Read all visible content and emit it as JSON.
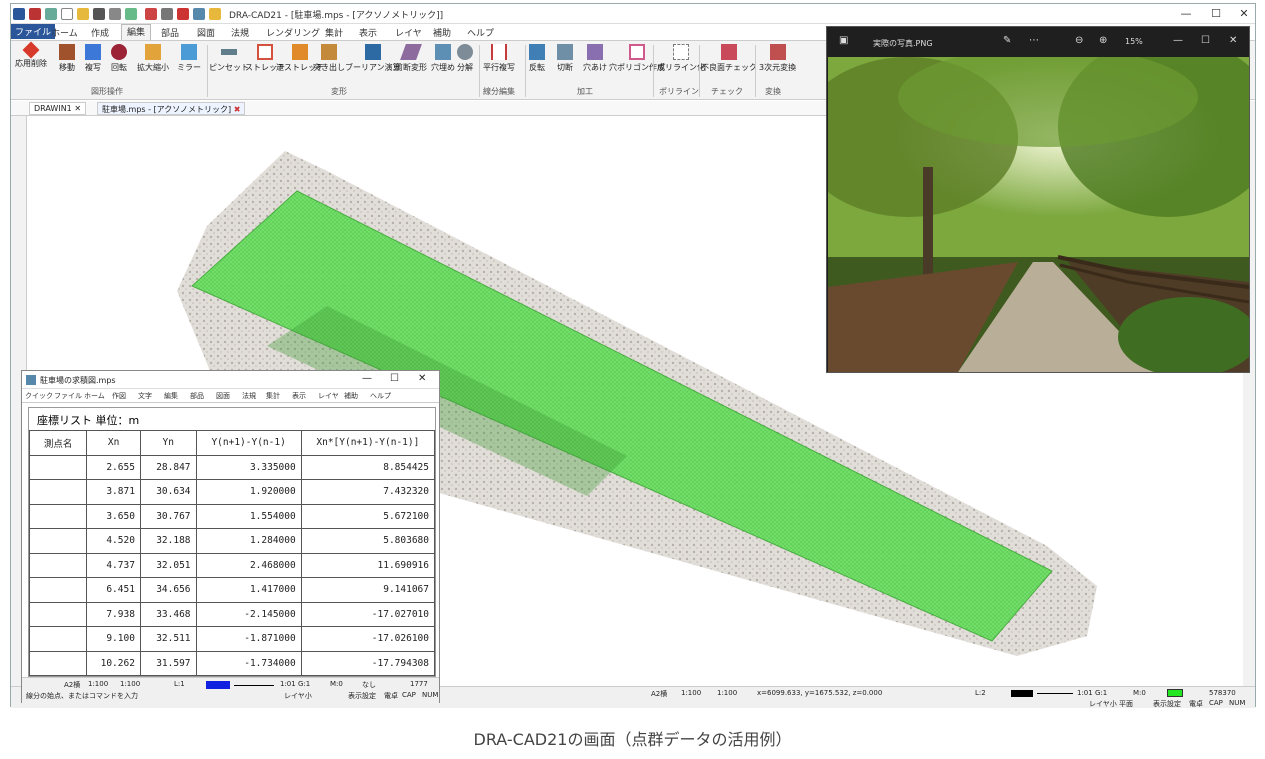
{
  "app": {
    "title": "DRA-CAD21 - [駐車場.mps - [アクソノメトリック]]",
    "window_controls": [
      "—",
      "☐",
      "✕"
    ]
  },
  "menu": {
    "items": [
      "ファイル",
      "ホーム",
      "作成",
      "編集",
      "部品",
      "図面",
      "法規",
      "レンダリング",
      "集計",
      "表示",
      "レイヤ",
      "補助",
      "ヘルプ"
    ],
    "active": "編集"
  },
  "ribbon": {
    "tools": [
      "応用削除",
      "移動",
      "複写",
      "回転",
      "拡大縮小",
      "ミラー",
      "ピンセット",
      "ストレッチ",
      "辺ストレッチ",
      "突き出し",
      "ブーリアン演算",
      "剪断変形",
      "穴埋め",
      "分解",
      "平行複写",
      "反転",
      "切断",
      "穴あけ",
      "穴ポリゴン作成",
      "ポリライン化",
      "不良面チェック",
      "3次元変換"
    ],
    "groups": [
      "図形操作",
      "変形",
      "線分編集",
      "加工",
      "ポリライン",
      "チェック",
      "変換"
    ],
    "colors": [
      "#d73a2b",
      "#a0522d",
      "#3c78d8",
      "#9b2335",
      "#e2a33b",
      "#4a9bd6",
      "#607d8b",
      "#d4513d",
      "#e08a2c",
      "#c48a3c",
      "#2d6aa3",
      "#8e6b9e",
      "#5c8fb3",
      "#7d8c96",
      "#c63b3b",
      "#3f7fb5",
      "#6f8fa6",
      "#8a6fb0",
      "#d05a8c",
      "#7b7b7b",
      "#c94a5a",
      "#c05050"
    ]
  },
  "doc_tabs": [
    "DRAWIN1",
    "駐車場.mps - [アクソノメトリック]"
  ],
  "status": {
    "scale1": "A2横",
    "scale2": "1:100",
    "scale3": "1:100",
    "layer": "L:1",
    "ratio": "1:01 G:1",
    "m": "M:0",
    "none": "なし",
    "count": "1777",
    "coords": "x=6099.633, y=1675.532, z=0.000",
    "layer2": "L:2",
    "ratio2": "1:01 G:1",
    "m2": "M:0",
    "count2": "578370",
    "right_labels": [
      "レイヤ小",
      "平面",
      "表示設定",
      "電卓",
      "CAP",
      "NUM"
    ]
  },
  "photo_viewer": {
    "title": "実際の写真.PNG",
    "zoom": "15%"
  },
  "table_window": {
    "title": "駐車場の求積図.mps",
    "menu": [
      "クイック",
      "ファイル",
      "ホーム",
      "作図",
      "文字",
      "編集",
      "部品",
      "図面",
      "法規",
      "集計",
      "表示",
      "レイヤ",
      "補助",
      "ヘルプ"
    ],
    "heading": "座標リスト 単位：m",
    "columns": [
      "測点名",
      "Xn",
      "Yn",
      "Y(n+1)-Y(n-1)",
      "Xn*[Y(n+1)-Y(n-1)]"
    ],
    "rows": [
      [
        "",
        "2.655",
        "28.847",
        "3.335000",
        "8.854425"
      ],
      [
        "",
        "3.871",
        "30.634",
        "1.920000",
        "7.432320"
      ],
      [
        "",
        "3.650",
        "30.767",
        "1.554000",
        "5.672100"
      ],
      [
        "",
        "4.520",
        "32.188",
        "1.284000",
        "5.803680"
      ],
      [
        "",
        "4.737",
        "32.051",
        "2.468000",
        "11.690916"
      ],
      [
        "",
        "6.451",
        "34.656",
        "1.417000",
        "9.141067"
      ],
      [
        "",
        "7.938",
        "33.468",
        "-2.145000",
        "-17.027010"
      ],
      [
        "",
        "9.100",
        "32.511",
        "-1.871000",
        "-17.026100"
      ],
      [
        "",
        "10.262",
        "31.597",
        "-1.734000",
        "-17.794308"
      ]
    ],
    "status_left": "線分の始点、またはコマンドを入力",
    "status_right": [
      "レイヤ小",
      "表示設定",
      "電卓",
      "CAP",
      "NUM"
    ]
  },
  "caption": "DRA-CAD21の画面（点群データの活用例）"
}
